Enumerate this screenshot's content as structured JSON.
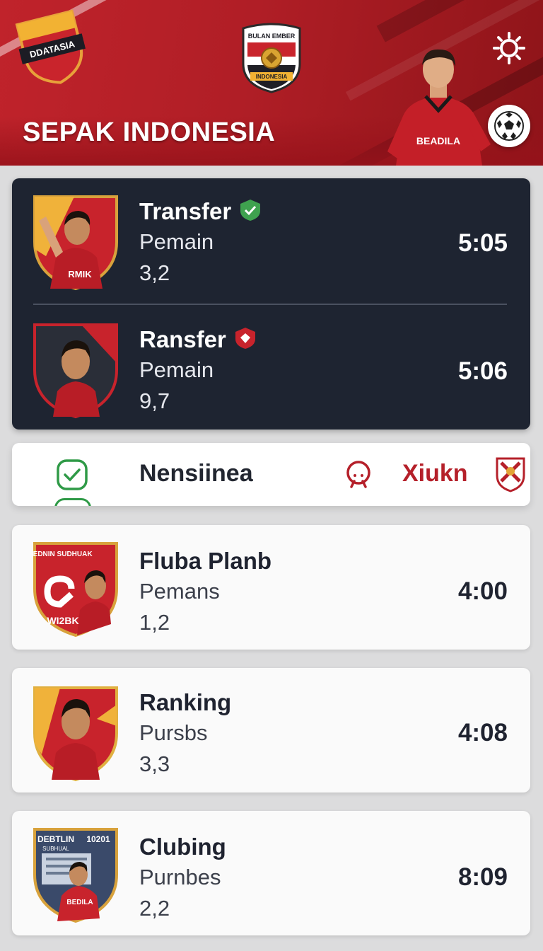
{
  "header": {
    "app_title": "SEPAK INDONESIA",
    "club_badge_text": "DDATASIA",
    "center_crest_top": "BULAN EMBER",
    "center_crest_bottom": "INDONESIA",
    "hero_shirt_text": "BEADILA",
    "colors": {
      "primary_red": "#c0232b",
      "dark_red": "#8e1419"
    }
  },
  "featured": {
    "rows": [
      {
        "title": "Transfer",
        "badge": "green-shield-icon",
        "subtitle": "Pemain",
        "value": "3,2",
        "time": "5:05",
        "shirt_text": "RMIK"
      },
      {
        "title": "Ransfer",
        "badge": "red-shield-icon",
        "subtitle": "Pemain",
        "value": "9,7",
        "time": "5:06",
        "shirt_text": ""
      }
    ]
  },
  "nav": {
    "label_left": "Nensiinea",
    "label_right": "Xiukn",
    "icons": [
      "check-icon",
      "search-icon",
      "club-crest-icon"
    ]
  },
  "list": {
    "items": [
      {
        "title": "Fluba Planb",
        "subtitle": "Pemans",
        "value": "1,2",
        "time": "4:00",
        "shield_top": "BEDNIN SUDHUAK",
        "shield_bottom": "WI2BK"
      },
      {
        "title": "Ranking",
        "subtitle": "Pursbs",
        "value": "3,3",
        "time": "4:08"
      },
      {
        "title": "Clubing",
        "subtitle": "Purnbes",
        "value": "2,2",
        "time": "8:09",
        "shield_top": "DEBTLIN",
        "shield_top_right": "10201",
        "shield_sub": "SUBHUAL",
        "shirt_text": "BEDILA"
      }
    ]
  }
}
